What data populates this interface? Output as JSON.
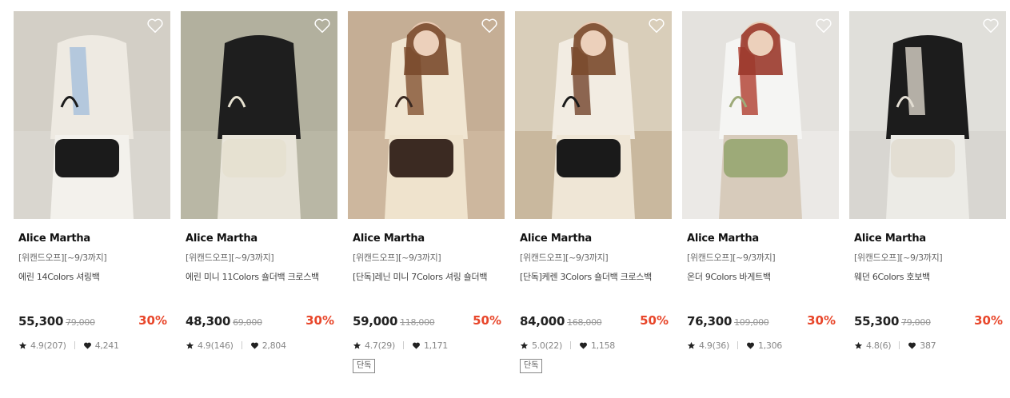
{
  "products": [
    {
      "brand": "Alice Martha",
      "promo": "[위캔드오프][~9/3까지]",
      "name": "에린 14Colors 셔링백",
      "price": "55,300",
      "original_price": "79,000",
      "discount": "30%",
      "rating": "4.9(207)",
      "likes": "4,241",
      "badge": null,
      "photo": {
        "bg": "#d9d6cf",
        "wall": "#cfcac0",
        "top": "#eeeae2",
        "accent": "#a9c2dc",
        "pants": "#f3f1ec",
        "bag": "#1b1b1b"
      }
    },
    {
      "brand": "Alice Martha",
      "promo": "[위캔드오프][~9/3까지]",
      "name": "에린 미니 11Colors 숄더백 크로스백",
      "price": "48,300",
      "original_price": "69,000",
      "discount": "30%",
      "rating": "4.9(146)",
      "likes": "2,804",
      "badge": null,
      "photo": {
        "bg": "#b9b7a5",
        "wall": "#aeac99",
        "top": "#1e1e1e",
        "accent": "#1e1e1e",
        "pants": "#e9e5da",
        "bag": "#e6e1d1"
      }
    },
    {
      "brand": "Alice Martha",
      "promo": "[위캔드오프][~9/3까지]",
      "name": "[단독]레닌 미니 7Colors 셔링 숄더백",
      "price": "59,000",
      "original_price": "118,000",
      "discount": "50%",
      "rating": "4.7(29)",
      "likes": "1,171",
      "badge": "단독",
      "photo": {
        "bg": "#cdb79e",
        "wall": "#bfa98f",
        "top": "#f1e6d2",
        "accent": "#8a5b3c",
        "pants": "#efe3cd",
        "bag": "#3b2a22"
      }
    },
    {
      "brand": "Alice Martha",
      "promo": "[위캔드오프][~9/3까지]",
      "name": "[단독]케렌 3Colors 숄더백 크로스백",
      "price": "84,000",
      "original_price": "168,000",
      "discount": "50%",
      "rating": "5.0(22)",
      "likes": "1,158",
      "badge": "단독",
      "photo": {
        "bg": "#c9b89e",
        "wall": "#e4dccd",
        "top": "#f2ece2",
        "accent": "#7a4e36",
        "pants": "#efe6d6",
        "bag": "#1a1a1a"
      }
    },
    {
      "brand": "Alice Martha",
      "promo": "[위캔드오프][~9/3까지]",
      "name": "온더 9Colors 바게트백",
      "price": "76,300",
      "original_price": "109,000",
      "discount": "30%",
      "rating": "4.9(36)",
      "likes": "1,306",
      "badge": null,
      "photo": {
        "bg": "#ebe9e6",
        "wall": "#e0ddd8",
        "top": "#f5f5f3",
        "accent": "#b4483a",
        "pants": "#d7cbbb",
        "bag": "#9daa78"
      }
    },
    {
      "brand": "Alice Martha",
      "promo": "[위캔드오프][~9/3까지]",
      "name": "웨던 6Colors 호보백",
      "price": "55,300",
      "original_price": "79,000",
      "discount": "30%",
      "rating": "4.8(6)",
      "likes": "387",
      "badge": null,
      "photo": {
        "bg": "#d8d6d1",
        "wall": "#e6e4e0",
        "top": "#1c1c1c",
        "accent": "#cfc9be",
        "pants": "#ecebe6",
        "bag": "#e3ded3"
      }
    }
  ],
  "colors": {
    "discount": "#e8462a",
    "price": "#222222",
    "muted": "#888888"
  },
  "icons": {
    "wishlist": "heart-outline-icon",
    "rating": "star-icon",
    "likes": "heart-filled-icon"
  }
}
